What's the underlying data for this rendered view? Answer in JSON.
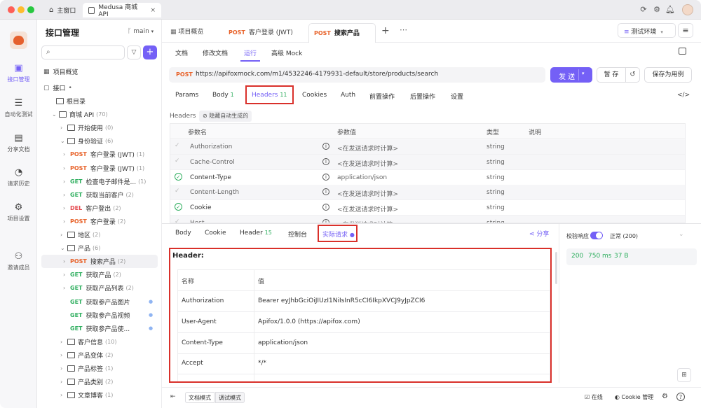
{
  "titlebar": {
    "tabs": [
      {
        "label": "主窗口"
      },
      {
        "label": "Medusa 商城 API"
      }
    ]
  },
  "iconbar": {
    "items": [
      {
        "label": "接口管理",
        "icon": "api-icon"
      },
      {
        "label": "自动化测试",
        "icon": "automation-icon"
      },
      {
        "label": "分享文档",
        "icon": "share-doc-icon"
      },
      {
        "label": "请求历史",
        "icon": "history-icon"
      },
      {
        "label": "项目设置",
        "icon": "settings-icon"
      },
      {
        "label": "邀请成员",
        "icon": "invite-icon"
      }
    ]
  },
  "tree": {
    "title": "接口管理",
    "branch": "main",
    "search_placeholder": "",
    "project_overview": "项目概览",
    "interface_label": "接口",
    "rows": [
      {
        "indent": 0,
        "kind": "folder",
        "label": "根目录",
        "count": ""
      },
      {
        "indent": 1,
        "kind": "folder",
        "label": "商城 API",
        "count": "(70)",
        "open": true
      },
      {
        "indent": 2,
        "kind": "folder",
        "label": "开始使用",
        "count": "(0)"
      },
      {
        "indent": 2,
        "kind": "folder",
        "label": "身份验证",
        "count": "(6)",
        "open": true
      },
      {
        "indent": 3,
        "kind": "api",
        "method": "POST",
        "label": "客户登录 (JWT)",
        "count": "(1)"
      },
      {
        "indent": 3,
        "kind": "api",
        "method": "POST",
        "label": "客户登录 (JWT)",
        "count": "(1)"
      },
      {
        "indent": 3,
        "kind": "api",
        "method": "GET",
        "label": "检查电子邮件是...",
        "count": "(1)"
      },
      {
        "indent": 3,
        "kind": "api",
        "method": "GET",
        "label": "获取当前客户",
        "count": "(2)"
      },
      {
        "indent": 3,
        "kind": "api",
        "method": "DEL",
        "label": "客户登出",
        "count": "(2)"
      },
      {
        "indent": 3,
        "kind": "api",
        "method": "POST",
        "label": "客户登录",
        "count": "(2)"
      },
      {
        "indent": 2,
        "kind": "folder",
        "label": "地区",
        "count": "(2)"
      },
      {
        "indent": 2,
        "kind": "folder",
        "label": "产品",
        "count": "(6)",
        "open": true
      },
      {
        "indent": 3,
        "kind": "api",
        "method": "POST",
        "label": "搜索产品",
        "count": "(2)",
        "selected": true
      },
      {
        "indent": 3,
        "kind": "api",
        "method": "GET",
        "label": "获取产品",
        "count": "(2)"
      },
      {
        "indent": 3,
        "kind": "api",
        "method": "GET",
        "label": "获取产品列表",
        "count": "(2)"
      },
      {
        "indent": 3,
        "kind": "api",
        "method": "GET",
        "label": "获取参产品图片",
        "count": "",
        "dot": true,
        "nochev": true
      },
      {
        "indent": 3,
        "kind": "api",
        "method": "GET",
        "label": "获取参产品视频",
        "count": "",
        "dot": true,
        "nochev": true
      },
      {
        "indent": 3,
        "kind": "api",
        "method": "GET",
        "label": "获取参产品使...",
        "count": "",
        "dot": true,
        "nochev": true
      },
      {
        "indent": 2,
        "kind": "folder",
        "label": "客户信息",
        "count": "(10)"
      },
      {
        "indent": 2,
        "kind": "folder",
        "label": "产品变体",
        "count": "(2)"
      },
      {
        "indent": 2,
        "kind": "folder",
        "label": "产品标签",
        "count": "(1)"
      },
      {
        "indent": 2,
        "kind": "folder",
        "label": "产品类别",
        "count": "(2)"
      },
      {
        "indent": 2,
        "kind": "folder",
        "label": "文章博客",
        "count": "(1)"
      }
    ]
  },
  "doc_tabs": {
    "items": [
      {
        "label": "项目概览",
        "method": ""
      },
      {
        "label": "客户登录 (JWT)",
        "method": "POST"
      },
      {
        "label": "搜索产品",
        "method": "POST"
      }
    ],
    "env": "测试环境"
  },
  "subtabs": [
    "文档",
    "修改文档",
    "运行",
    "高级 Mock"
  ],
  "request": {
    "method": "POST",
    "url": "https://apifoxmock.com/m1/4532246-4179931-default/store/products/search",
    "send": "发 送",
    "save_draft": "暂 存",
    "save_as_case": "保存为用例"
  },
  "param_tabs": [
    {
      "label": "Params",
      "count": ""
    },
    {
      "label": "Body",
      "count": "1"
    },
    {
      "label": "Headers",
      "count": "11"
    },
    {
      "label": "Cookies",
      "count": ""
    },
    {
      "label": "Auth",
      "count": ""
    },
    {
      "label": "前置操作",
      "count": ""
    },
    {
      "label": "后置操作",
      "count": ""
    },
    {
      "label": "设置",
      "count": ""
    }
  ],
  "headers_panel": {
    "label": "Headers",
    "hide_auto": "隐藏自动生成的",
    "columns": [
      "参数名",
      "参数值",
      "类型",
      "说明"
    ],
    "rows": [
      {
        "name": "Authorization",
        "value": "<在发送请求时计算>",
        "type": "string",
        "enabled": false
      },
      {
        "name": "Cache-Control",
        "value": "<在发送请求时计算>",
        "type": "string",
        "enabled": false
      },
      {
        "name": "Content-Type",
        "value": "application/json",
        "type": "string",
        "enabled": true
      },
      {
        "name": "Content-Length",
        "value": "<在发送请求时计算>",
        "type": "string",
        "enabled": false
      },
      {
        "name": "Cookie",
        "value": "<在发送请求时计算>",
        "type": "string",
        "enabled": true
      },
      {
        "name": "Host",
        "value": "<在发送请求时计算>",
        "type": "string",
        "enabled": false
      }
    ]
  },
  "response_tabs": [
    {
      "label": "Body",
      "count": ""
    },
    {
      "label": "Cookie",
      "count": ""
    },
    {
      "label": "Header",
      "count": "15"
    },
    {
      "label": "控制台",
      "count": ""
    },
    {
      "label": "实际请求",
      "count": ""
    }
  ],
  "share_label": "分享",
  "actual_request": {
    "heading": "Header:",
    "columns": [
      "名称",
      "值"
    ],
    "rows": [
      {
        "name": "Authorization",
        "value": "Bearer eyJhbGciOiJIUzI1NiIsInR5cCI6IkpXVCJ9yJpZCI6"
      },
      {
        "name": "User-Agent",
        "value": "Apifox/1.0.0 (https://apifox.com)"
      },
      {
        "name": "Content-Type",
        "value": "application/json"
      },
      {
        "name": "Accept",
        "value": "*/*"
      }
    ]
  },
  "validation": {
    "label": "校验响应",
    "status": "正常 (200)",
    "code": "200",
    "time": "750 ms",
    "size": "37 B"
  },
  "statusbar": {
    "doc_mode": "文档模式",
    "debug_mode": "调试模式",
    "online": "在线",
    "cookie": "Cookie 管理"
  },
  "colors": {
    "accent": "#7460f6",
    "post": "#e8632b",
    "get": "#2eae5e",
    "delete": "#e5484d",
    "highlight": "#d9302a"
  }
}
